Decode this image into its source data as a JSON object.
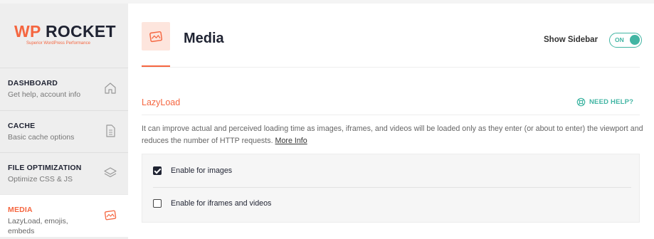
{
  "brand": {
    "logo_prefix": "WP",
    "logo_word": "ROCKET",
    "tagline": "Superior WordPress Performance",
    "accent_color": "#f56640",
    "teal_color": "#41b5a3"
  },
  "sidebar": {
    "items": [
      {
        "title": "DASHBOARD",
        "description": "Get help, account info",
        "icon": "home-icon"
      },
      {
        "title": "CACHE",
        "description": "Basic cache options",
        "icon": "document-icon"
      },
      {
        "title": "FILE OPTIMIZATION",
        "description": "Optimize CSS & JS",
        "icon": "layers-icon"
      },
      {
        "title": "MEDIA",
        "description": "LazyLoad, emojis, embeds",
        "icon": "media-icon",
        "active": true
      }
    ]
  },
  "header": {
    "title": "Media",
    "show_sidebar_label": "Show Sidebar",
    "toggle_state": "ON"
  },
  "lazyload": {
    "title": "LazyLoad",
    "help_label": "NEED HELP?",
    "description": "It can improve actual and perceived loading time as images, iframes, and videos will be loaded only as they enter (or about to enter) the viewport and reduces the number of HTTP requests.",
    "more_info": "More Info",
    "options": [
      {
        "label": "Enable for images",
        "checked": true
      },
      {
        "label": "Enable for iframes and videos",
        "checked": false
      }
    ]
  }
}
